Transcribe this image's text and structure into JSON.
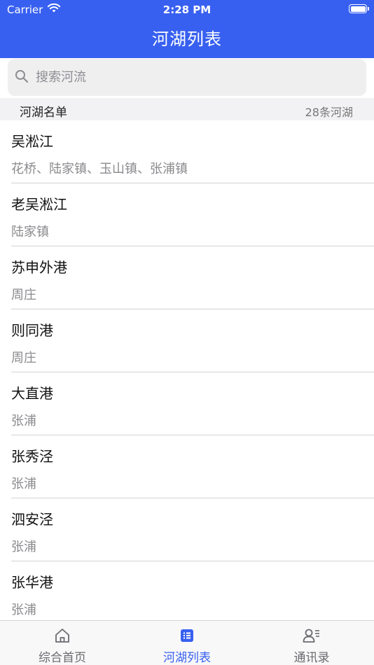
{
  "status_bar": {
    "carrier": "Carrier",
    "time": "2:28 PM",
    "icons": [
      "wifi-icon",
      "battery-icon"
    ]
  },
  "nav": {
    "title": "河湖列表"
  },
  "search": {
    "placeholder": "搜索河流",
    "value": "",
    "icon": "search-icon"
  },
  "section": {
    "title": "河湖名单",
    "count": "28条河湖"
  },
  "rivers": [
    {
      "name": "吴淞江",
      "towns": "花桥、陆家镇、玉山镇、张浦镇"
    },
    {
      "name": "老吴淞江",
      "towns": "陆家镇"
    },
    {
      "name": "苏申外港",
      "towns": "周庄"
    },
    {
      "name": "则同港",
      "towns": "周庄"
    },
    {
      "name": "大直港",
      "towns": "张浦"
    },
    {
      "name": "张秀泾",
      "towns": "张浦"
    },
    {
      "name": "泗安泾",
      "towns": "张浦"
    },
    {
      "name": "张华港",
      "towns": "张浦"
    }
  ],
  "tabs": [
    {
      "label": "综合首页",
      "icon": "home-icon",
      "active": false
    },
    {
      "label": "河湖列表",
      "icon": "list-icon",
      "active": true
    },
    {
      "label": "通讯录",
      "icon": "contacts-icon",
      "active": false
    }
  ],
  "colors": {
    "accent": "#3860f0",
    "inactive": "#6b6b70",
    "subtitle": "#8a8a8e"
  }
}
